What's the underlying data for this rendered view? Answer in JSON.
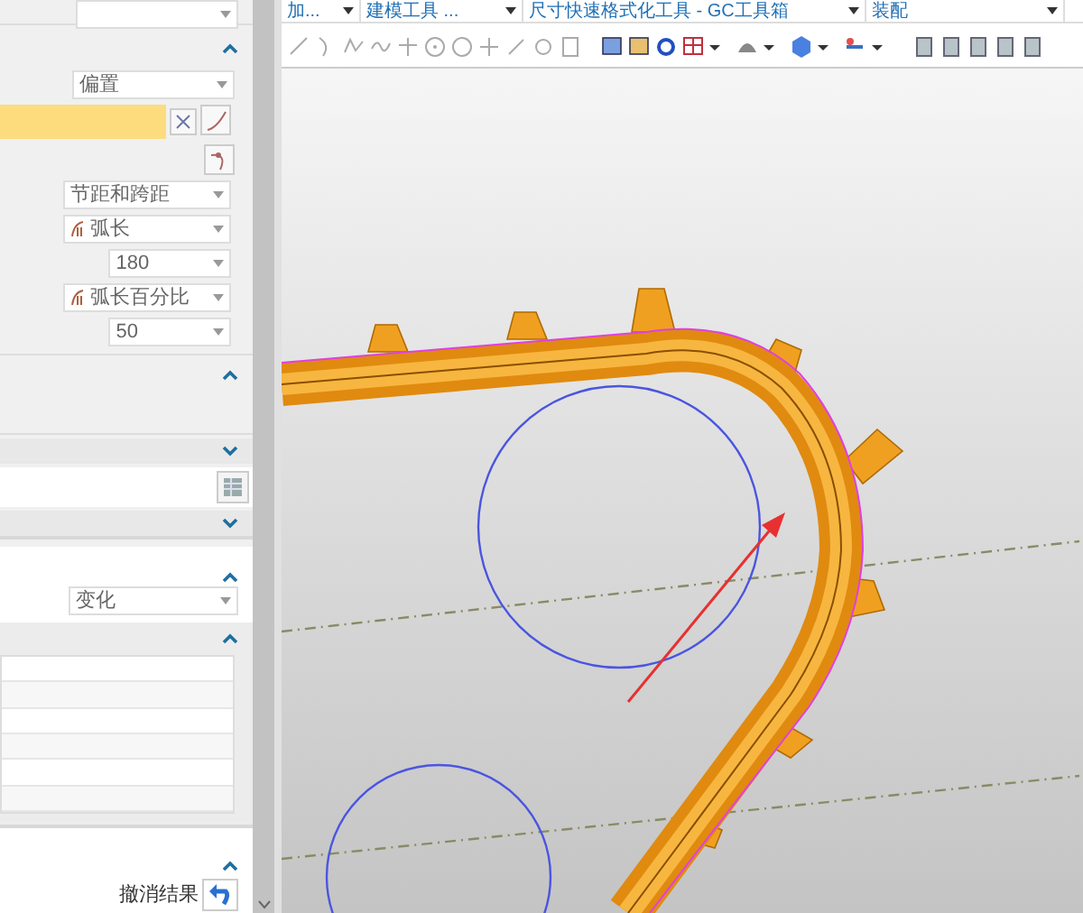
{
  "toolbar": {
    "tabs": [
      {
        "label": "加..."
      },
      {
        "label": "建模工具 ..."
      },
      {
        "label": "尺寸快速格式化工具 - GC工具箱"
      },
      {
        "label": "装配"
      }
    ]
  },
  "panel": {
    "sections": [
      {
        "kind": "form",
        "expanded": true,
        "method": "偏置",
        "rows": [
          {
            "kind": "dropdown",
            "value": "节距和跨距"
          },
          {
            "kind": "icon-dropdown",
            "value": "弧长"
          },
          {
            "kind": "number",
            "value": "180"
          },
          {
            "kind": "icon-dropdown",
            "value": "弧长百分比"
          },
          {
            "kind": "number",
            "value": "50"
          }
        ]
      },
      {
        "kind": "blank",
        "expanded": true
      },
      {
        "kind": "picker",
        "expanded": false
      },
      {
        "kind": "header",
        "expanded": false
      },
      {
        "kind": "choice",
        "expanded": true,
        "value": "变化"
      },
      {
        "kind": "list",
        "expanded": true
      },
      {
        "kind": "result",
        "expanded": true,
        "label": "撤消结果"
      }
    ]
  }
}
